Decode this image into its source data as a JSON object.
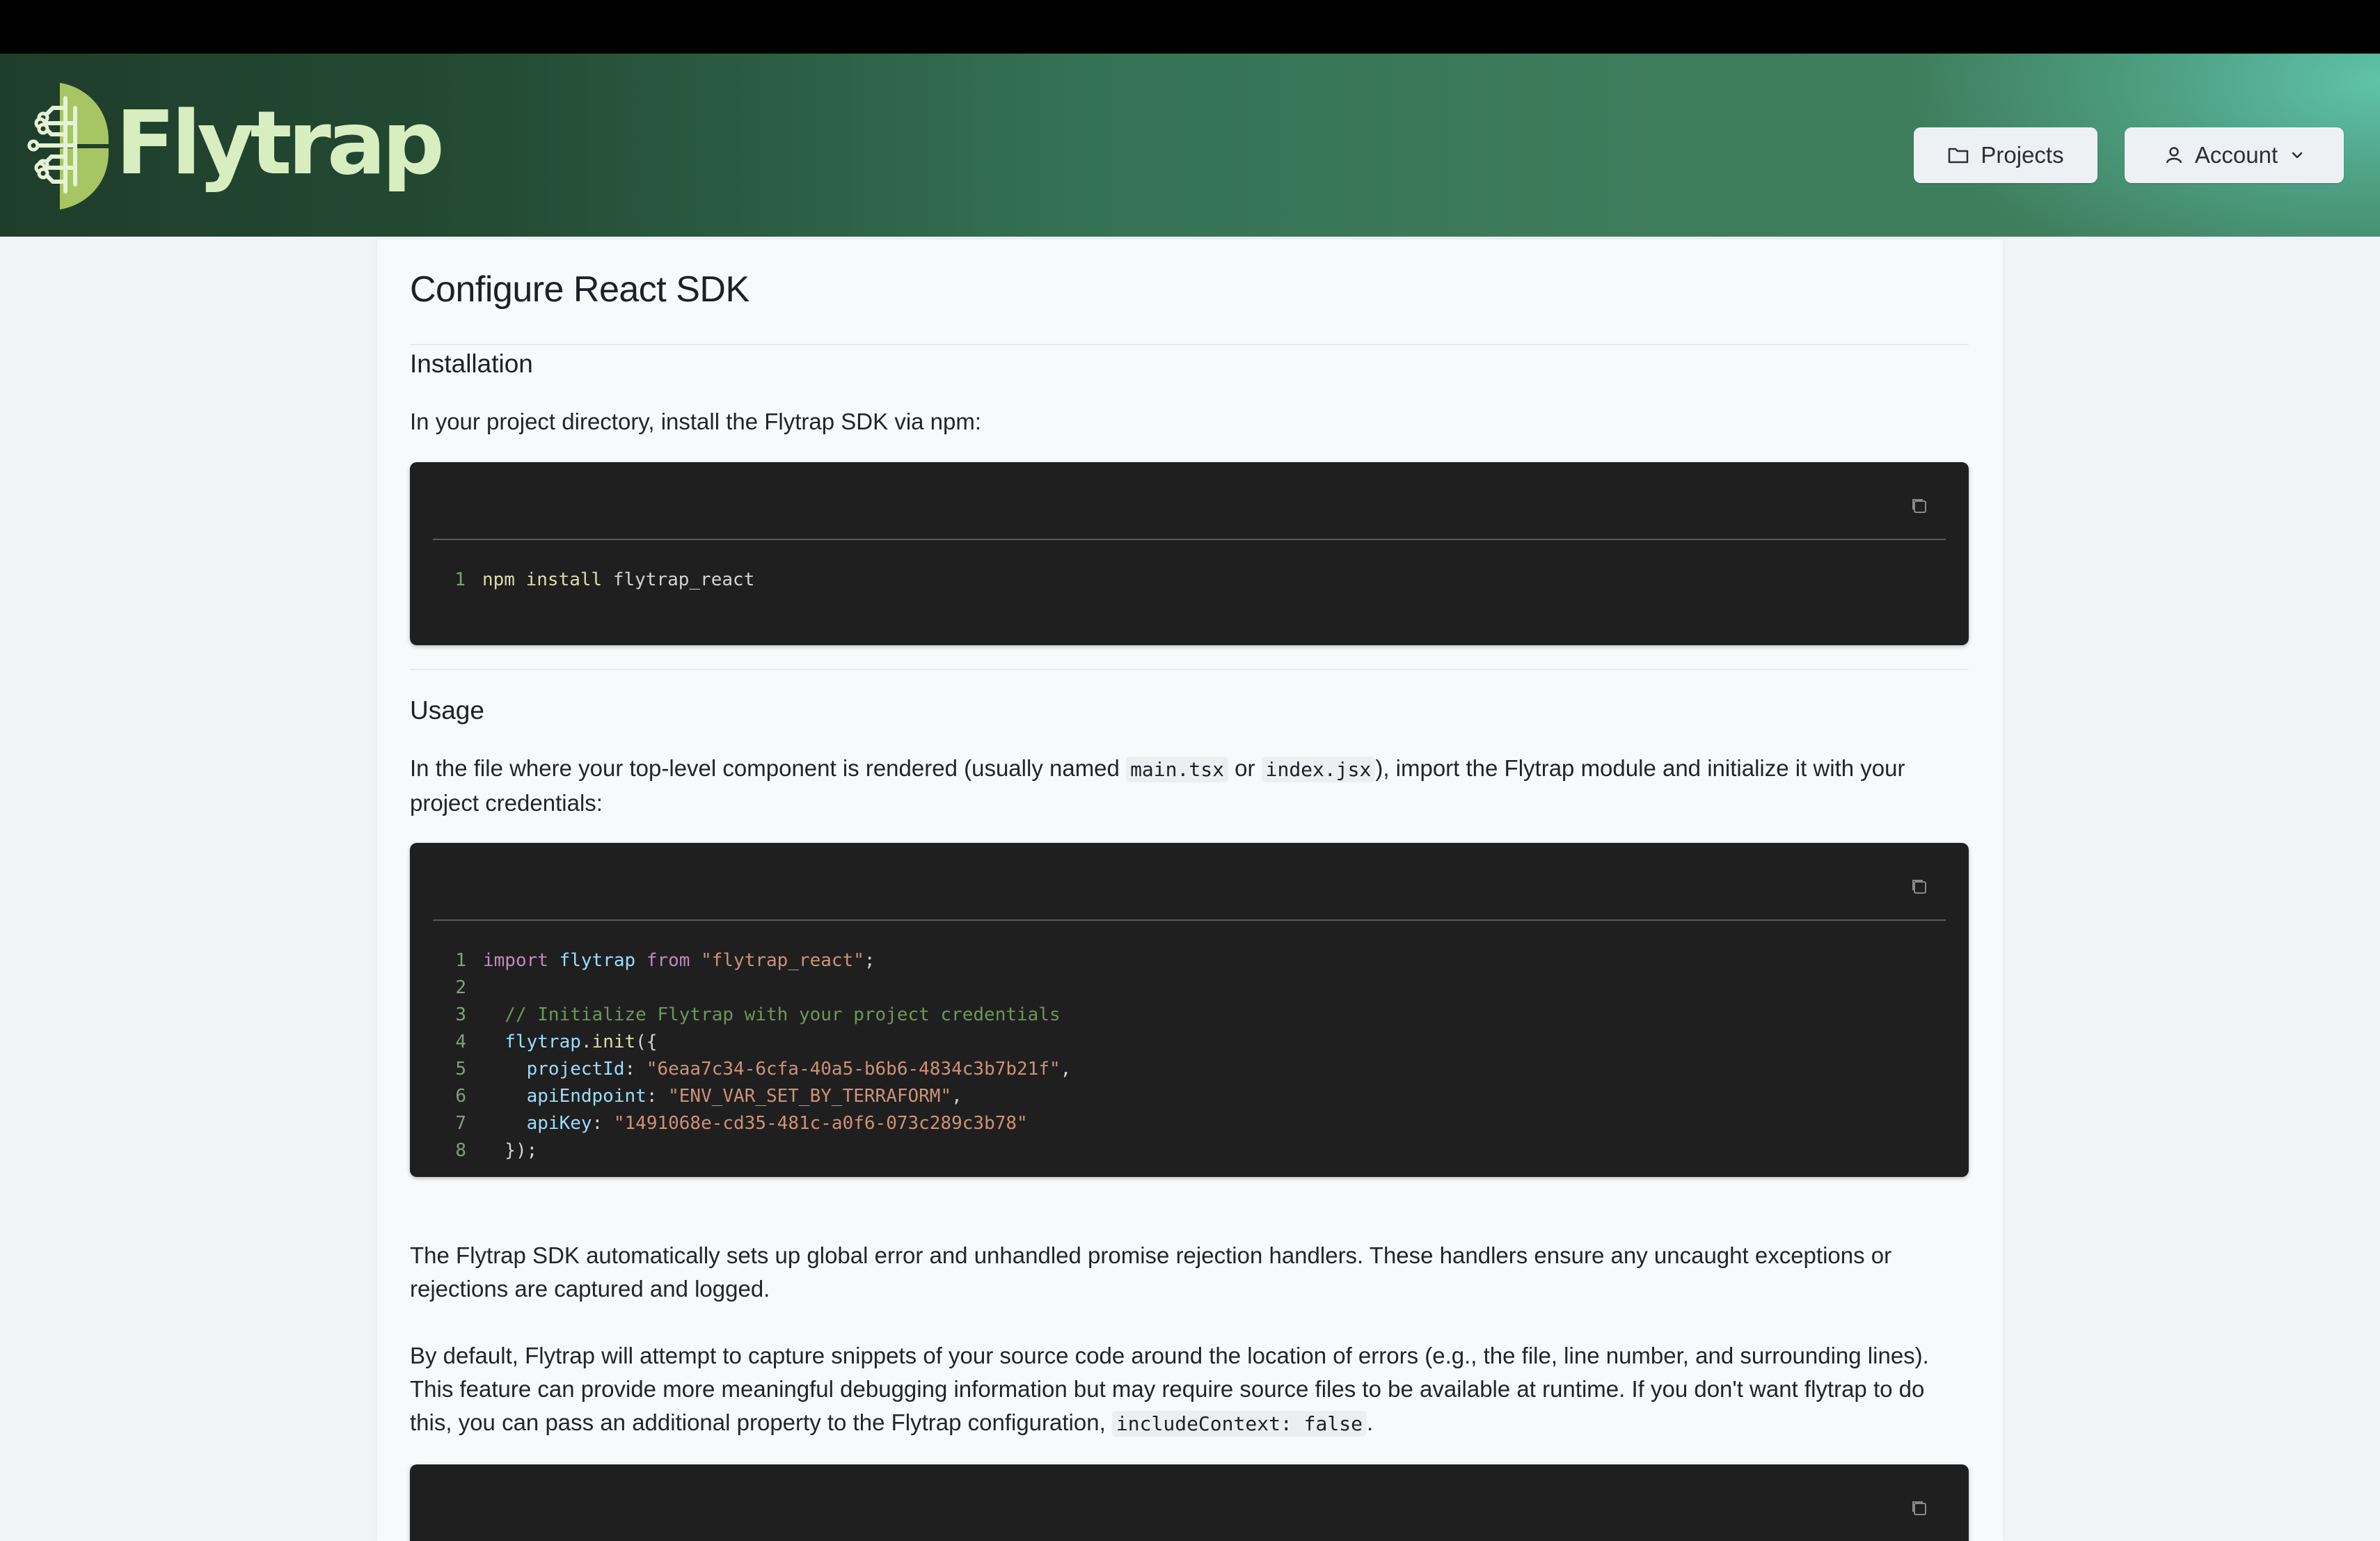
{
  "app": {
    "brand": "Flytrap",
    "nav": {
      "projects_label": "Projects",
      "account_label": "Account"
    }
  },
  "page": {
    "title": "Configure React SDK",
    "installation": {
      "heading": "Installation",
      "text": "In your project directory, install the Flytrap SDK via npm:",
      "code": [
        {
          "n": "1",
          "cmd": "npm",
          "sub": "install",
          "arg": "flytrap_react"
        }
      ]
    },
    "usage": {
      "heading": "Usage",
      "text_1": "In the file where your top-level component is rendered (usually named ",
      "code_a": "main.tsx",
      "text_or": " or ",
      "code_b": "index.jsx",
      "text_2": "), import the Flytrap module and initialize it with your project credentials:",
      "code_lines": [
        {
          "n": "1",
          "a": "import",
          "b": " flytrap ",
          "c": "from",
          "d": " \"flytrap_react\"",
          "e": ";"
        },
        {
          "n": "2"
        },
        {
          "n": "3",
          "comment": "  // Initialize Flytrap with your project credentials"
        },
        {
          "n": "4",
          "obj": "  flytrap",
          "dot": ".",
          "fn": "init",
          "rest": "({"
        },
        {
          "n": "5",
          "key": "    projectId",
          "colon": ": ",
          "val": "\"6eaa7c34-6cfa-40a5-b6b6-4834c3b7b21f\"",
          "end": ","
        },
        {
          "n": "6",
          "key": "    apiEndpoint",
          "colon": ": ",
          "val": "\"ENV_VAR_SET_BY_TERRAFORM\"",
          "end": ","
        },
        {
          "n": "7",
          "key": "    apiKey",
          "colon": ": ",
          "val": "\"1491068e-cd35-481c-a0f6-073c289c3b78\"",
          "end": ""
        },
        {
          "n": "8",
          "close": "  });"
        }
      ],
      "para_2": "The Flytrap SDK automatically sets up global error and unhandled promise rejection handlers. These handlers ensure any uncaught exceptions or rejections are captured and logged.",
      "para_3": "By default, Flytrap will attempt to capture snippets of your source code around the location of errors (e.g., the file, line number, and surrounding lines). This feature can provide more meaningful debugging information but may require source files to be available at runtime. If you don't want flytrap to do this, you can pass an additional property to the Flytrap configuration, ",
      "code_c": "includeContext: false",
      "para_3_end": "."
    }
  },
  "icons": {
    "logo": "flytrap-circuit-leaf-logo",
    "projects": "folder-icon",
    "account": "user-icon",
    "chevron": "chevron-down-icon",
    "copy": "copy-icon"
  },
  "colors": {
    "header_dark": "#1f3d2b",
    "header_light": "#5fc3ab",
    "logo_text": "#d7eec0",
    "code_bg": "#1f1f1f"
  }
}
